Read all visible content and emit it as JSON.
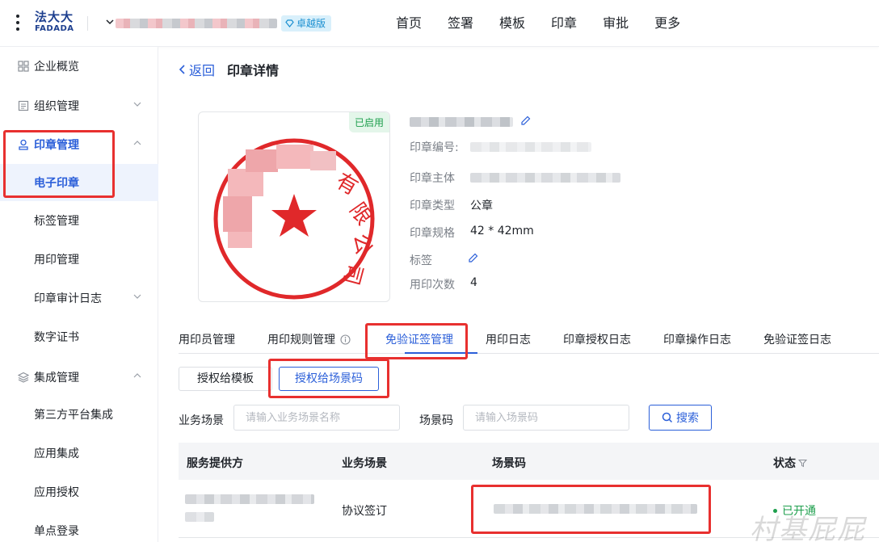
{
  "header": {
    "logo_cn": "法大大",
    "logo_en": "FADADA",
    "edition_badge": "卓越版",
    "nav": [
      "首页",
      "签署",
      "模板",
      "印章",
      "审批",
      "更多"
    ]
  },
  "sidebar": {
    "items": [
      {
        "label": "企业概览",
        "icon": "grid-icon"
      },
      {
        "label": "组织管理",
        "icon": "org-icon"
      },
      {
        "label": "印章管理",
        "icon": "seal-icon"
      },
      {
        "label": "电子印章"
      },
      {
        "label": "标签管理"
      },
      {
        "label": "用印管理"
      },
      {
        "label": "印章审计日志"
      },
      {
        "label": "数字证书"
      },
      {
        "label": "集成管理",
        "icon": "layers-icon"
      },
      {
        "label": "第三方平台集成"
      },
      {
        "label": "应用集成"
      },
      {
        "label": "应用授权"
      },
      {
        "label": "单点登录"
      }
    ]
  },
  "page": {
    "back_label": "返回",
    "title": "印章详情"
  },
  "seal": {
    "status_tag": "已启用",
    "seal_text_visible": "有限公司",
    "fields": [
      {
        "label": "印章编号:",
        "value": ""
      },
      {
        "label": "印章主体",
        "value": ""
      },
      {
        "label": "印章类型",
        "value": "公章"
      },
      {
        "label": "印章规格",
        "value": "42 * 42mm"
      },
      {
        "label": "标签",
        "value": ""
      },
      {
        "label": "用印次数",
        "value": "4"
      }
    ]
  },
  "tabs": [
    "用印员管理",
    "用印规则管理",
    "免验证签管理",
    "用印日志",
    "印章授权日志",
    "印章操作日志",
    "免验证签日志"
  ],
  "active_tab": "免验证签管理",
  "segments": [
    "授权给模板",
    "授权给场景码"
  ],
  "filters": {
    "scene_label": "业务场景",
    "scene_placeholder": "请输入业务场景名称",
    "code_label": "场景码",
    "code_placeholder": "请输入场景码",
    "search_label": "搜索"
  },
  "table": {
    "columns": [
      "服务提供方",
      "业务场景",
      "场景码",
      "状态"
    ],
    "rows": [
      {
        "provider": "",
        "scene": "协议签订",
        "code": "",
        "status": "已开通"
      }
    ]
  },
  "watermark": "村基屁屁",
  "colors": {
    "primary": "#2b5fd9",
    "success": "#1e9f4d",
    "seal_red": "#e0282a",
    "highlight": "#e8302f"
  }
}
